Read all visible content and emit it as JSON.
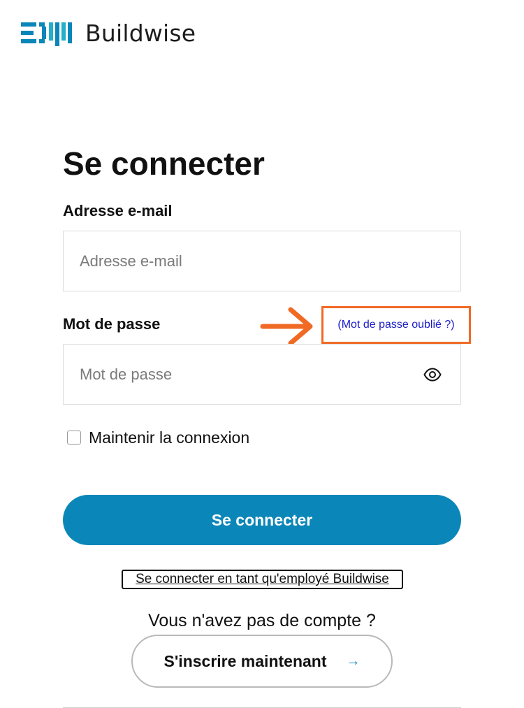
{
  "brand": {
    "name": "Buildwise",
    "accent_color": "#0b86b8",
    "icon": "buildwise-logo-icon"
  },
  "login": {
    "title": "Se connecter",
    "email_label": "Adresse e-mail",
    "email_placeholder": "Adresse e-mail",
    "email_value": "",
    "password_label": "Mot de passe",
    "password_placeholder": "Mot de passe",
    "password_value": "",
    "forgot_link": "(Mot de passe oublié ?)",
    "show_password_icon": "eye-icon",
    "remember_label": "Maintenir la connexion",
    "remember_checked": false,
    "submit_label": "Se connecter",
    "employee_link": "Se connecter en tant qu'employé Buildwise"
  },
  "signup": {
    "prompt": "Vous n'avez pas de compte ?",
    "button_label": "S'inscrire maintenant",
    "button_icon": "→"
  },
  "annotation": {
    "highlight_color": "#f06a25",
    "arrow_icon": "orange-arrow-icon"
  }
}
